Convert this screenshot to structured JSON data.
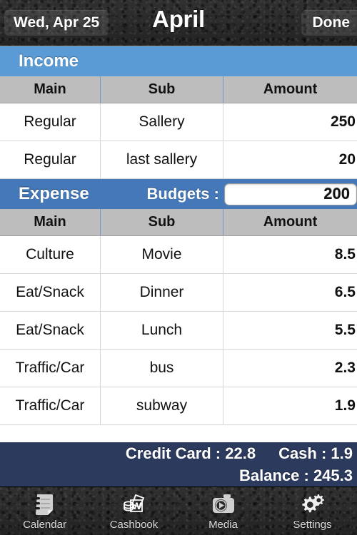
{
  "navbar": {
    "back_label": "Wed, Apr 25",
    "title": "April",
    "done_label": "Done"
  },
  "income": {
    "section_title": "Income",
    "columns": {
      "main": "Main",
      "sub": "Sub",
      "amount": "Amount"
    },
    "rows": [
      {
        "main": "Regular",
        "sub": "Sallery",
        "amount": "250"
      },
      {
        "main": "Regular",
        "sub": "last sallery",
        "amount": "20"
      }
    ]
  },
  "expense": {
    "section_title": "Expense",
    "budget_label": "Budgets :",
    "budget_value": "200",
    "columns": {
      "main": "Main",
      "sub": "Sub",
      "amount": "Amount"
    },
    "rows": [
      {
        "main": "Culture",
        "sub": "Movie",
        "amount": "8.5"
      },
      {
        "main": "Eat/Snack",
        "sub": "Dinner",
        "amount": "6.5"
      },
      {
        "main": "Eat/Snack",
        "sub": "Lunch",
        "amount": "5.5"
      },
      {
        "main": "Traffic/Car",
        "sub": "bus",
        "amount": "2.3"
      },
      {
        "main": "Traffic/Car",
        "sub": "subway",
        "amount": "1.9"
      }
    ]
  },
  "summary": {
    "credit_card": "Credit Card : 22.8",
    "cash": "Cash : 1.9",
    "balance": "Balance : 245.3"
  },
  "tabbar": {
    "items": [
      {
        "label": "Calendar",
        "icon": "notepad-icon"
      },
      {
        "label": "Cashbook",
        "icon": "cashbook-icon"
      },
      {
        "label": "Media",
        "icon": "camera-play-icon"
      },
      {
        "label": "Settings",
        "icon": "gears-icon"
      }
    ]
  },
  "colors": {
    "income_header": "#5a9bd5",
    "expense_header": "#4478b8",
    "column_header": "#bdbdbd",
    "income_amount": "#0000e8",
    "expense_amount": "#e81111",
    "summary_bar": "#2c3a5e"
  }
}
